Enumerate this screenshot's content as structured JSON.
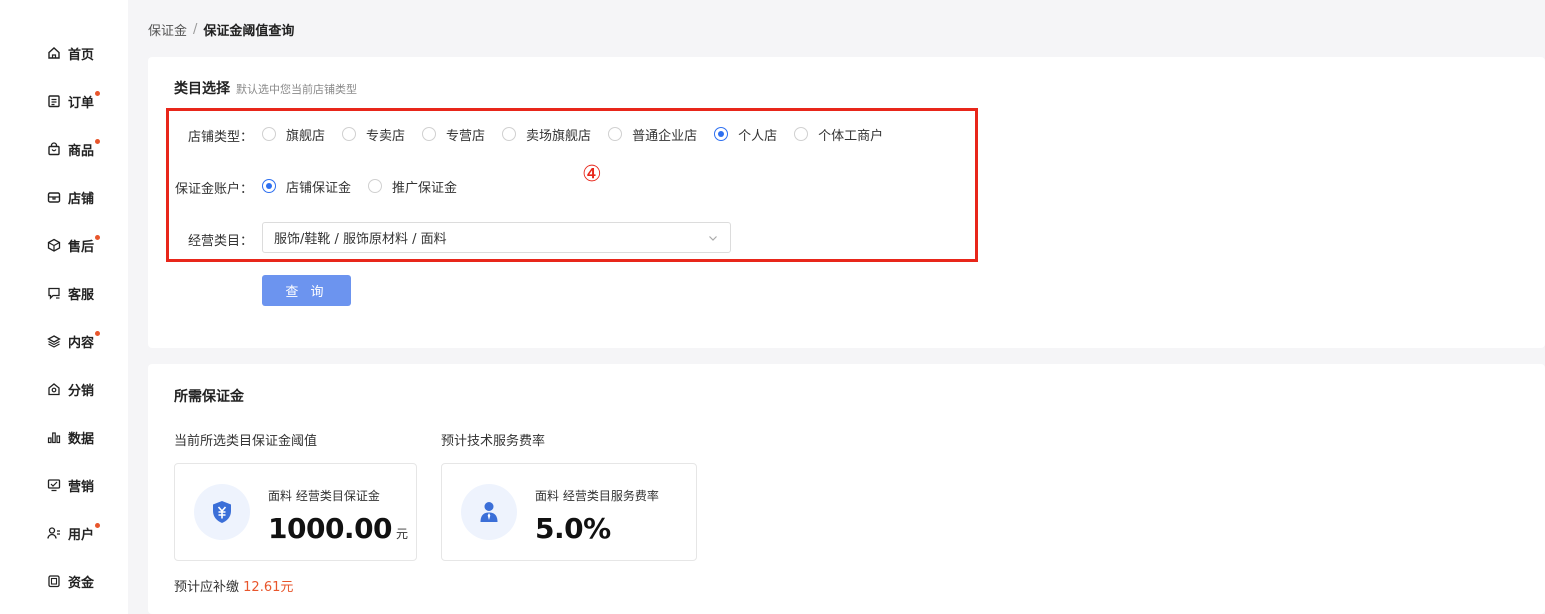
{
  "sidebar": {
    "items": [
      {
        "label": "首页",
        "icon": "home-icon",
        "dot": false
      },
      {
        "label": "订单",
        "icon": "order-icon",
        "dot": true
      },
      {
        "label": "商品",
        "icon": "bag-icon",
        "dot": true
      },
      {
        "label": "店铺",
        "icon": "store-icon",
        "dot": false
      },
      {
        "label": "售后",
        "icon": "box-icon",
        "dot": true
      },
      {
        "label": "客服",
        "icon": "chat-icon",
        "dot": false
      },
      {
        "label": "内容",
        "icon": "layers-icon",
        "dot": true
      },
      {
        "label": "分销",
        "icon": "distribution-icon",
        "dot": false
      },
      {
        "label": "数据",
        "icon": "bar-chart-icon",
        "dot": false
      },
      {
        "label": "营销",
        "icon": "marketing-icon",
        "dot": false
      },
      {
        "label": "用户",
        "icon": "user-icon",
        "dot": true
      },
      {
        "label": "资金",
        "icon": "wallet-icon",
        "dot": false
      }
    ],
    "dot_color": "#e8562c"
  },
  "breadcrumb": {
    "parent": "保证金",
    "separator": "/",
    "current": "保证金阈值查询"
  },
  "category": {
    "title": "类目选择",
    "subtitle": "默认选中您当前店铺类型",
    "store_type": {
      "label": "店铺类型：",
      "options": [
        "旗舰店",
        "专卖店",
        "专营店",
        "卖场旗舰店",
        "普通企业店",
        "个人店",
        "个体工商户"
      ],
      "selected": "个人店"
    },
    "account": {
      "label": "保证金账户：",
      "options": [
        "店铺保证金",
        "推广保证金"
      ],
      "selected": "店铺保证金"
    },
    "business": {
      "label": "经营类目：",
      "value": "服饰/鞋靴 / 服饰原材料 / 面料"
    },
    "query_button": "查 询",
    "annotation": "④"
  },
  "deposit": {
    "title": "所需保证金",
    "threshold_label": "当前所选类目保证金阈值",
    "rate_label": "预计技术服务费率",
    "threshold_card": {
      "caption": "面料 经营类目保证金",
      "value": "1000.00",
      "unit": "元",
      "icon": "shield-yuan-icon"
    },
    "rate_card": {
      "caption": "面料 经营类目服务费率",
      "value": "5.0%",
      "icon": "person-icon"
    },
    "extra_label": "预计应补缴",
    "extra_amount": "12.61元"
  },
  "colors": {
    "accent": "#2d6ff0",
    "button": "#6c94ef",
    "highlight": "#e8261a",
    "warning": "#e8562c"
  }
}
